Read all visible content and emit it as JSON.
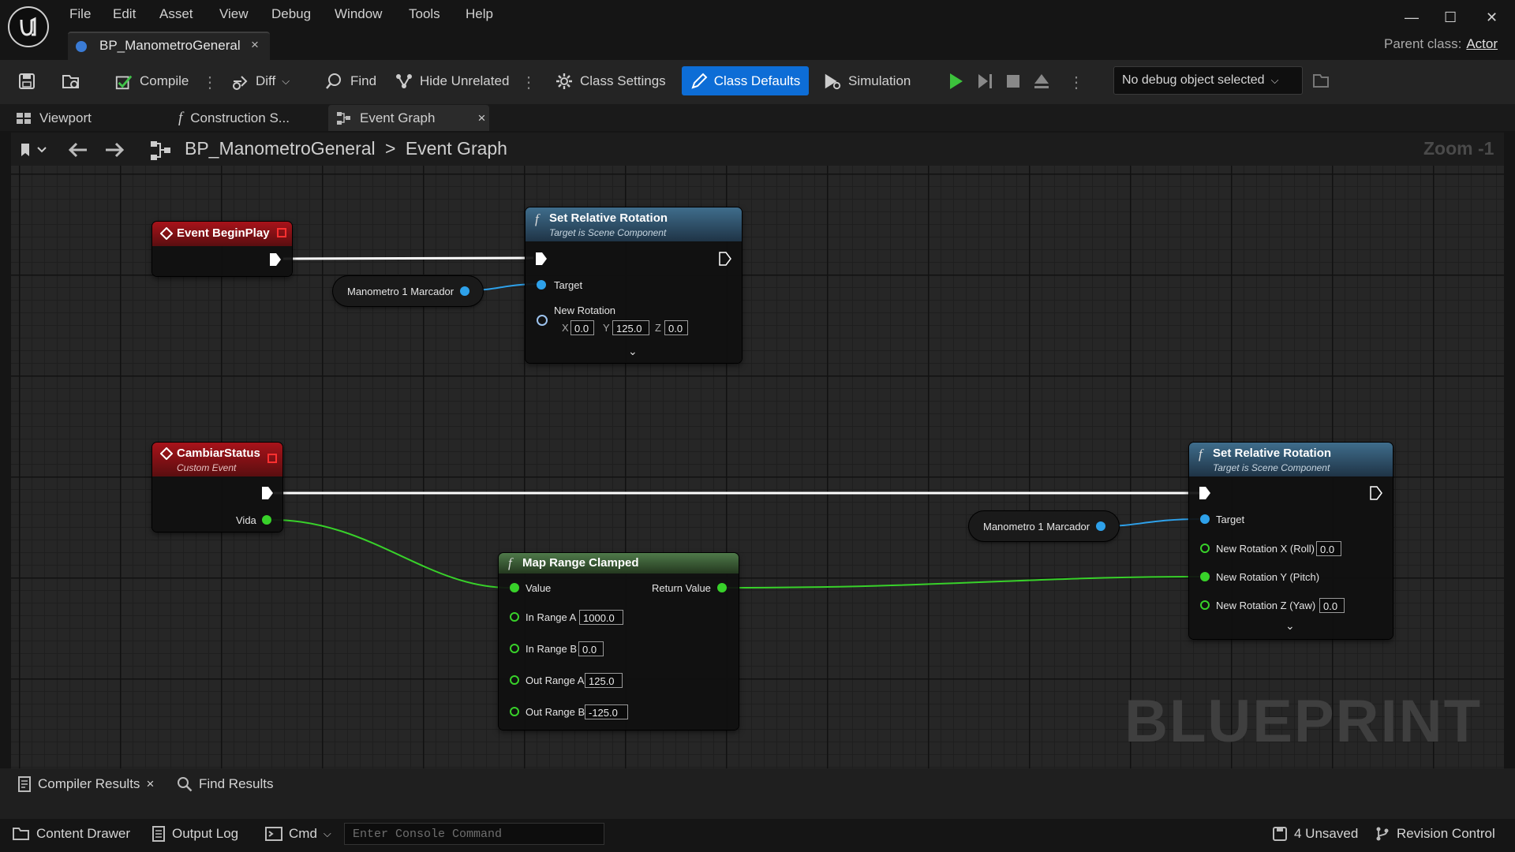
{
  "menu": [
    "File",
    "Edit",
    "Asset",
    "View",
    "Debug",
    "Window",
    "Tools",
    "Help"
  ],
  "doc_tab": {
    "label": "BP_ManometroGeneral",
    "close": "×"
  },
  "parent_class": {
    "label": "Parent class:",
    "value": "Actor"
  },
  "toolbar": {
    "compile": "Compile",
    "diff": "Diff",
    "find": "Find",
    "hide_unrelated": "Hide Unrelated",
    "class_settings": "Class Settings",
    "class_defaults": "Class Defaults",
    "simulation": "Simulation",
    "debug_object": "No debug object selected"
  },
  "graph_tabs": {
    "viewport": "Viewport",
    "construction": "Construction S...",
    "event_graph": "Event Graph",
    "close": "×"
  },
  "breadcrumb": {
    "root": "BP_ManometroGeneral",
    "sep": ">",
    "current": "Event Graph"
  },
  "zoom": "Zoom -1",
  "watermark": "BLUEPRINT",
  "nodes": {
    "begin_play": {
      "title": "Event BeginPlay"
    },
    "set_rot_1": {
      "title": "Set Relative Rotation",
      "subtitle": "Target is Scene Component",
      "target": "Target",
      "new_rotation": "New Rotation",
      "x_label": "X",
      "x": "0.0",
      "y_label": "Y",
      "y": "125.0",
      "z_label": "Z",
      "z": "0.0"
    },
    "var_1": {
      "label": "Manometro 1 Marcador"
    },
    "cambiar": {
      "title": "CambiarStatus",
      "subtitle": "Custom Event",
      "vida": "Vida"
    },
    "map_range": {
      "title": "Map Range Clamped",
      "value": "Value",
      "return_value": "Return Value",
      "in_range_a": "In Range A",
      "in_range_a_val": "1000.0",
      "in_range_b": "In Range B",
      "in_range_b_val": "0.0",
      "out_range_a": "Out Range A",
      "out_range_a_val": "125.0",
      "out_range_b": "Out Range B",
      "out_range_b_val": "-125.0"
    },
    "var_2": {
      "label": "Manometro 1 Marcador"
    },
    "set_rot_2": {
      "title": "Set Relative Rotation",
      "subtitle": "Target is Scene Component",
      "target": "Target",
      "roll": "New Rotation X (Roll)",
      "roll_val": "0.0",
      "pitch": "New Rotation Y (Pitch)",
      "yaw": "New Rotation Z (Yaw)",
      "yaw_val": "0.0"
    }
  },
  "bottom": {
    "compiler_results": "Compiler Results",
    "close": "×",
    "find_results": "Find Results"
  },
  "status": {
    "content_drawer": "Content Drawer",
    "output_log": "Output Log",
    "cmd": "Cmd",
    "console_placeholder": "Enter Console Command",
    "unsaved": "4 Unsaved",
    "revision_control": "Revision Control"
  },
  "colors": {
    "accent": "#0d6dd6",
    "exec_wire": "#ffffff",
    "object_pin": "#2ea1ea",
    "float_pin": "#38d12a",
    "event_header": "#a8131a",
    "function_header": "#3f6d8c",
    "pure_header": "#4f7a4a"
  }
}
